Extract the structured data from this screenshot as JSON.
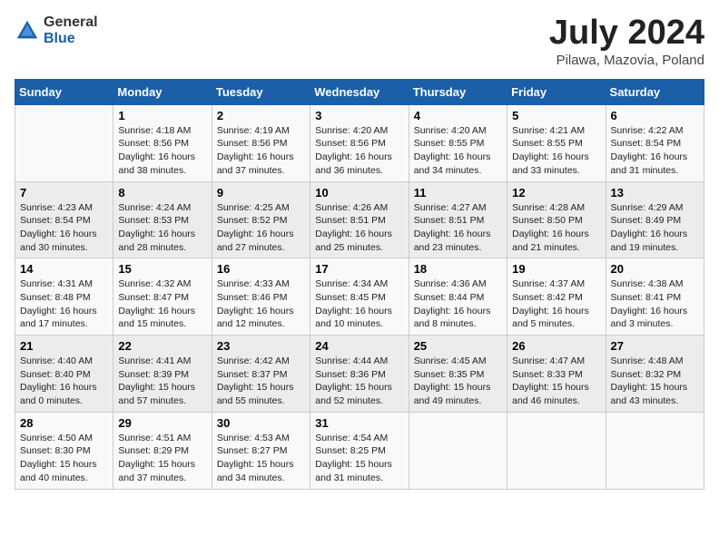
{
  "header": {
    "logo_general": "General",
    "logo_blue": "Blue",
    "month_title": "July 2024",
    "location": "Pilawa, Mazovia, Poland"
  },
  "days_of_week": [
    "Sunday",
    "Monday",
    "Tuesday",
    "Wednesday",
    "Thursday",
    "Friday",
    "Saturday"
  ],
  "weeks": [
    [
      {
        "day": "",
        "sunrise": "",
        "sunset": "",
        "daylight": ""
      },
      {
        "day": "1",
        "sunrise": "Sunrise: 4:18 AM",
        "sunset": "Sunset: 8:56 PM",
        "daylight": "Daylight: 16 hours and 38 minutes."
      },
      {
        "day": "2",
        "sunrise": "Sunrise: 4:19 AM",
        "sunset": "Sunset: 8:56 PM",
        "daylight": "Daylight: 16 hours and 37 minutes."
      },
      {
        "day": "3",
        "sunrise": "Sunrise: 4:20 AM",
        "sunset": "Sunset: 8:56 PM",
        "daylight": "Daylight: 16 hours and 36 minutes."
      },
      {
        "day": "4",
        "sunrise": "Sunrise: 4:20 AM",
        "sunset": "Sunset: 8:55 PM",
        "daylight": "Daylight: 16 hours and 34 minutes."
      },
      {
        "day": "5",
        "sunrise": "Sunrise: 4:21 AM",
        "sunset": "Sunset: 8:55 PM",
        "daylight": "Daylight: 16 hours and 33 minutes."
      },
      {
        "day": "6",
        "sunrise": "Sunrise: 4:22 AM",
        "sunset": "Sunset: 8:54 PM",
        "daylight": "Daylight: 16 hours and 31 minutes."
      }
    ],
    [
      {
        "day": "7",
        "sunrise": "Sunrise: 4:23 AM",
        "sunset": "Sunset: 8:54 PM",
        "daylight": "Daylight: 16 hours and 30 minutes."
      },
      {
        "day": "8",
        "sunrise": "Sunrise: 4:24 AM",
        "sunset": "Sunset: 8:53 PM",
        "daylight": "Daylight: 16 hours and 28 minutes."
      },
      {
        "day": "9",
        "sunrise": "Sunrise: 4:25 AM",
        "sunset": "Sunset: 8:52 PM",
        "daylight": "Daylight: 16 hours and 27 minutes."
      },
      {
        "day": "10",
        "sunrise": "Sunrise: 4:26 AM",
        "sunset": "Sunset: 8:51 PM",
        "daylight": "Daylight: 16 hours and 25 minutes."
      },
      {
        "day": "11",
        "sunrise": "Sunrise: 4:27 AM",
        "sunset": "Sunset: 8:51 PM",
        "daylight": "Daylight: 16 hours and 23 minutes."
      },
      {
        "day": "12",
        "sunrise": "Sunrise: 4:28 AM",
        "sunset": "Sunset: 8:50 PM",
        "daylight": "Daylight: 16 hours and 21 minutes."
      },
      {
        "day": "13",
        "sunrise": "Sunrise: 4:29 AM",
        "sunset": "Sunset: 8:49 PM",
        "daylight": "Daylight: 16 hours and 19 minutes."
      }
    ],
    [
      {
        "day": "14",
        "sunrise": "Sunrise: 4:31 AM",
        "sunset": "Sunset: 8:48 PM",
        "daylight": "Daylight: 16 hours and 17 minutes."
      },
      {
        "day": "15",
        "sunrise": "Sunrise: 4:32 AM",
        "sunset": "Sunset: 8:47 PM",
        "daylight": "Daylight: 16 hours and 15 minutes."
      },
      {
        "day": "16",
        "sunrise": "Sunrise: 4:33 AM",
        "sunset": "Sunset: 8:46 PM",
        "daylight": "Daylight: 16 hours and 12 minutes."
      },
      {
        "day": "17",
        "sunrise": "Sunrise: 4:34 AM",
        "sunset": "Sunset: 8:45 PM",
        "daylight": "Daylight: 16 hours and 10 minutes."
      },
      {
        "day": "18",
        "sunrise": "Sunrise: 4:36 AM",
        "sunset": "Sunset: 8:44 PM",
        "daylight": "Daylight: 16 hours and 8 minutes."
      },
      {
        "day": "19",
        "sunrise": "Sunrise: 4:37 AM",
        "sunset": "Sunset: 8:42 PM",
        "daylight": "Daylight: 16 hours and 5 minutes."
      },
      {
        "day": "20",
        "sunrise": "Sunrise: 4:38 AM",
        "sunset": "Sunset: 8:41 PM",
        "daylight": "Daylight: 16 hours and 3 minutes."
      }
    ],
    [
      {
        "day": "21",
        "sunrise": "Sunrise: 4:40 AM",
        "sunset": "Sunset: 8:40 PM",
        "daylight": "Daylight: 16 hours and 0 minutes."
      },
      {
        "day": "22",
        "sunrise": "Sunrise: 4:41 AM",
        "sunset": "Sunset: 8:39 PM",
        "daylight": "Daylight: 15 hours and 57 minutes."
      },
      {
        "day": "23",
        "sunrise": "Sunrise: 4:42 AM",
        "sunset": "Sunset: 8:37 PM",
        "daylight": "Daylight: 15 hours and 55 minutes."
      },
      {
        "day": "24",
        "sunrise": "Sunrise: 4:44 AM",
        "sunset": "Sunset: 8:36 PM",
        "daylight": "Daylight: 15 hours and 52 minutes."
      },
      {
        "day": "25",
        "sunrise": "Sunrise: 4:45 AM",
        "sunset": "Sunset: 8:35 PM",
        "daylight": "Daylight: 15 hours and 49 minutes."
      },
      {
        "day": "26",
        "sunrise": "Sunrise: 4:47 AM",
        "sunset": "Sunset: 8:33 PM",
        "daylight": "Daylight: 15 hours and 46 minutes."
      },
      {
        "day": "27",
        "sunrise": "Sunrise: 4:48 AM",
        "sunset": "Sunset: 8:32 PM",
        "daylight": "Daylight: 15 hours and 43 minutes."
      }
    ],
    [
      {
        "day": "28",
        "sunrise": "Sunrise: 4:50 AM",
        "sunset": "Sunset: 8:30 PM",
        "daylight": "Daylight: 15 hours and 40 minutes."
      },
      {
        "day": "29",
        "sunrise": "Sunrise: 4:51 AM",
        "sunset": "Sunset: 8:29 PM",
        "daylight": "Daylight: 15 hours and 37 minutes."
      },
      {
        "day": "30",
        "sunrise": "Sunrise: 4:53 AM",
        "sunset": "Sunset: 8:27 PM",
        "daylight": "Daylight: 15 hours and 34 minutes."
      },
      {
        "day": "31",
        "sunrise": "Sunrise: 4:54 AM",
        "sunset": "Sunset: 8:25 PM",
        "daylight": "Daylight: 15 hours and 31 minutes."
      },
      {
        "day": "",
        "sunrise": "",
        "sunset": "",
        "daylight": ""
      },
      {
        "day": "",
        "sunrise": "",
        "sunset": "",
        "daylight": ""
      },
      {
        "day": "",
        "sunrise": "",
        "sunset": "",
        "daylight": ""
      }
    ]
  ]
}
